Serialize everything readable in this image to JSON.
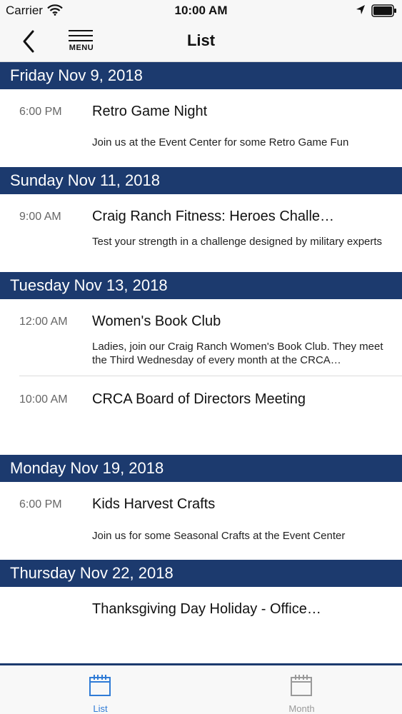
{
  "status": {
    "carrier": "Carrier",
    "time": "10:00 AM"
  },
  "nav": {
    "menu_label": "MENU",
    "title": "List"
  },
  "days": [
    {
      "date": "Friday Nov 9, 2018",
      "events": [
        {
          "time": "6:00 PM",
          "title": "Retro Game Night",
          "desc": "Join us at the Event Center for some Retro Game Fun"
        }
      ]
    },
    {
      "date": "Sunday Nov 11, 2018",
      "events": [
        {
          "time": "9:00 AM",
          "title": "Craig Ranch Fitness: Heroes Challe…",
          "desc": "Test your strength in a challenge designed by military experts"
        }
      ]
    },
    {
      "date": "Tuesday Nov 13, 2018",
      "events": [
        {
          "time": "12:00 AM",
          "title": "Women's Book Club",
          "desc": "Ladies, join our Craig Ranch Women's Book Club.  They meet the Third Wednesday of every month at the CRCA…"
        },
        {
          "time": "10:00 AM",
          "title": "CRCA Board of Directors Meeting",
          "desc": ""
        }
      ]
    },
    {
      "date": "Monday Nov 19, 2018",
      "events": [
        {
          "time": "6:00 PM",
          "title": "Kids Harvest Crafts",
          "desc": "Join us for some Seasonal Crafts at the Event Center"
        }
      ]
    },
    {
      "date": "Thursday Nov 22, 2018",
      "events": [
        {
          "time": "",
          "title": "Thanksgiving Day Holiday - Office…",
          "desc": ""
        }
      ]
    }
  ],
  "tabs": [
    {
      "label": "List",
      "icon": "calendar-icon",
      "active": true,
      "color": "#2f7bd6"
    },
    {
      "label": "Month",
      "icon": "calendar-icon",
      "active": false,
      "color": "#9a9a9a"
    }
  ],
  "colors": {
    "header_bg": "#1c3a6e",
    "active_tab": "#2f7bd6",
    "inactive_tab": "#9a9a9a"
  }
}
